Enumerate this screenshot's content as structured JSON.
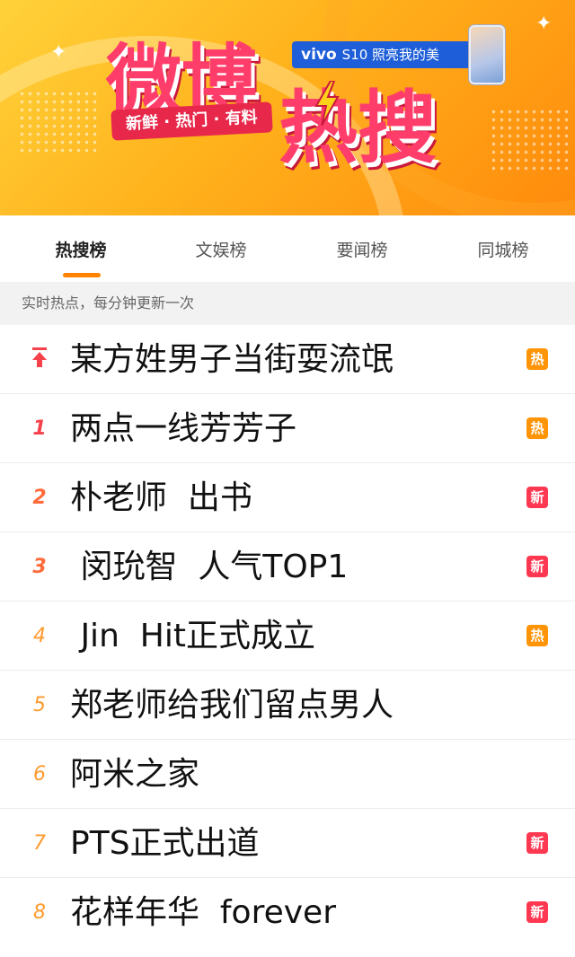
{
  "banner": {
    "logo_line1": "微博",
    "logo_line2": "热搜",
    "tagline": "新鲜 · 热门 · 有料",
    "ad_brand": "vivo",
    "ad_text": "S10 照亮我的美"
  },
  "tabs": [
    {
      "label": "热搜榜",
      "active": true
    },
    {
      "label": "文娱榜",
      "active": false
    },
    {
      "label": "要闻榜",
      "active": false
    },
    {
      "label": "同城榜",
      "active": false
    }
  ],
  "notice": "实时热点，每分钟更新一次",
  "colors": {
    "accent": "#ff8200",
    "hot_badge": "#ff9406",
    "new_badge": "#ff3852",
    "rank_top": "#f5424b"
  },
  "list": [
    {
      "rank": "",
      "pinned": true,
      "icon": "pin-top-icon",
      "title": "某方姓男子当街耍流氓",
      "badge": "热",
      "badge_type": "hot"
    },
    {
      "rank": "1",
      "title": "两点一线芳芳子",
      "badge": "热",
      "badge_type": "hot"
    },
    {
      "rank": "2",
      "title": "朴老师  出书",
      "badge": "新",
      "badge_type": "new"
    },
    {
      "rank": "3",
      "title": " 闵玧智  人气TOP1",
      "badge": "新",
      "badge_type": "new"
    },
    {
      "rank": "4",
      "title": " Jin  Hit正式成立",
      "badge": "热",
      "badge_type": "hot"
    },
    {
      "rank": "5",
      "title": "郑老师给我们留点男人",
      "badge": "",
      "badge_type": ""
    },
    {
      "rank": "6",
      "title": "阿米之家",
      "badge": "",
      "badge_type": ""
    },
    {
      "rank": "7",
      "title": "PTS正式出道",
      "badge": "新",
      "badge_type": "new"
    },
    {
      "rank": "8",
      "title": "花样年华  forever",
      "badge": "新",
      "badge_type": "new"
    }
  ]
}
